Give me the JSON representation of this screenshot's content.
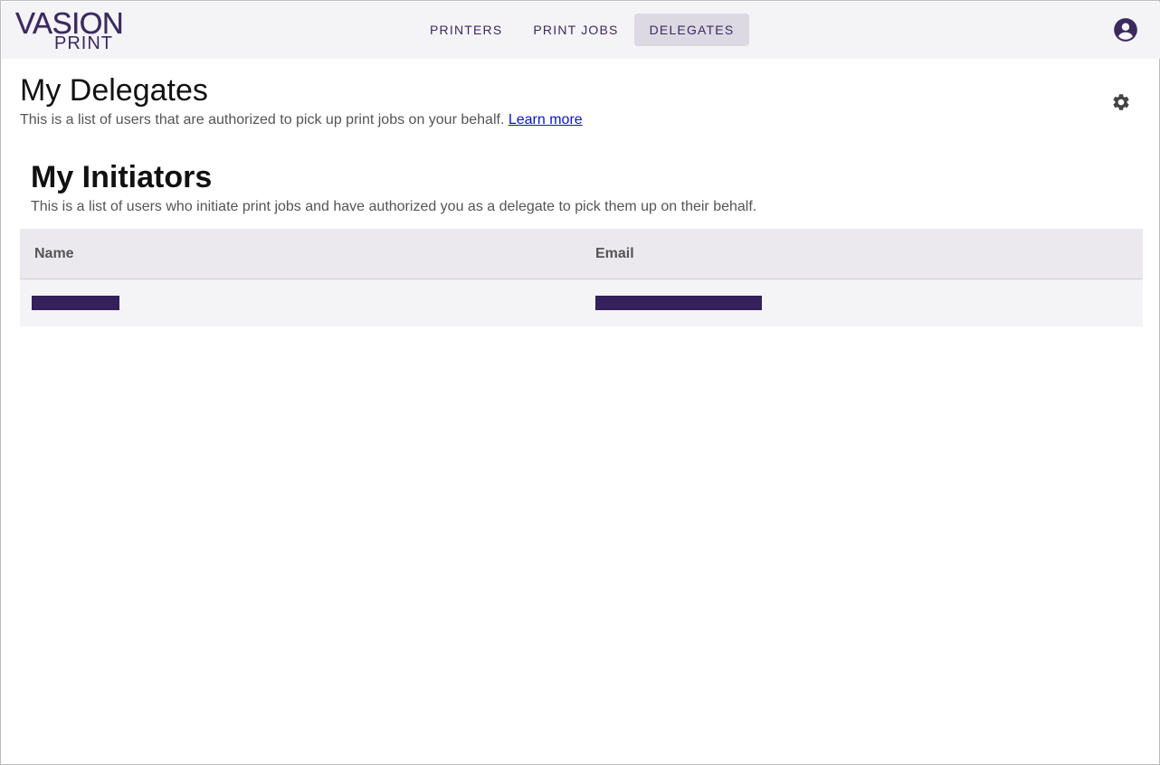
{
  "brand": {
    "logo_top": "VASION",
    "logo_bottom": "PRINT",
    "color": "#3b2a5e"
  },
  "nav": {
    "tabs": [
      {
        "label": "PRINTERS",
        "active": false
      },
      {
        "label": "PRINT JOBS",
        "active": false
      },
      {
        "label": "DELEGATES",
        "active": true
      }
    ]
  },
  "header": {
    "account_icon": "account-circle-icon"
  },
  "delegates": {
    "title": "My Delegates",
    "description": "This is a list of users that are authorized to pick up print jobs on your behalf.",
    "learn_more": "Learn more",
    "settings_icon": "gear-icon"
  },
  "initiators": {
    "title": "My Initiators",
    "description": "This is a list of users who initiate print jobs and have authorized you as a delegate to pick them up on their behalf.",
    "columns": [
      "Name",
      "Email"
    ],
    "rows": [
      {
        "name": "[redacted]",
        "email": "[redacted]"
      }
    ]
  },
  "colors": {
    "redaction": "#34205a",
    "accent": "#3b2a5e",
    "link": "#0a14c9"
  }
}
